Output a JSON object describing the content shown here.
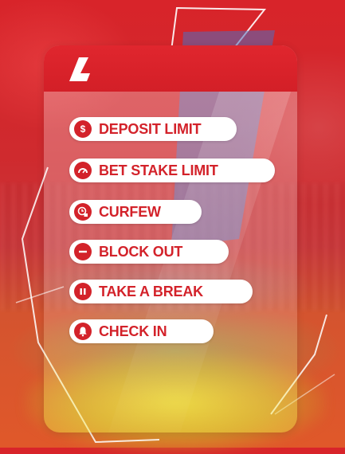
{
  "brand": {
    "logo_icon": "ladbrokes-l-logo-icon",
    "accent": "#d3222a",
    "header_color": "#e0262e"
  },
  "items": [
    {
      "label": "DEPOSIT LIMIT",
      "icon": "dollar-coin-icon"
    },
    {
      "label": "BET STAKE LIMIT",
      "icon": "speedometer-icon"
    },
    {
      "label": "CURFEW",
      "icon": "clock-lock-icon"
    },
    {
      "label": "BLOCK OUT",
      "icon": "minus-circle-icon"
    },
    {
      "label": "TAKE A BREAK",
      "icon": "pause-icon"
    },
    {
      "label": "CHECK IN",
      "icon": "bell-icon"
    }
  ]
}
